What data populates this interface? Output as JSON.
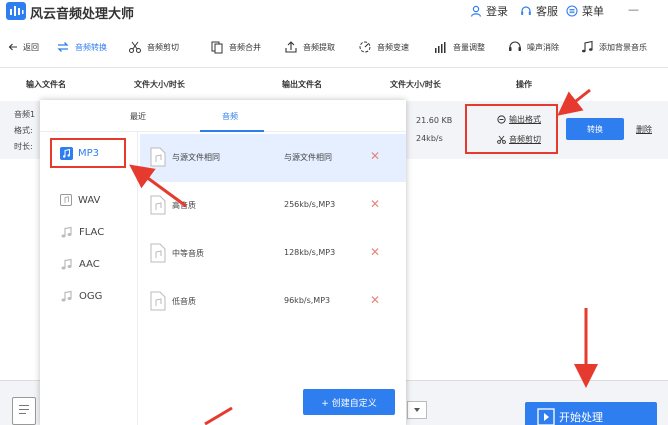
{
  "app": {
    "title": "风云音频处理大师",
    "login_label": "登录",
    "service_label": "客服",
    "menu_label": "菜单",
    "minimize_glyph": "—"
  },
  "toolbar": {
    "items": [
      {
        "label": "返回",
        "icon": "back-arrow-icon"
      },
      {
        "label": "音频转换",
        "icon": "convert-icon",
        "active": true
      },
      {
        "label": "音频剪切",
        "icon": "scissors-icon"
      },
      {
        "label": "音频合并",
        "icon": "merge-icon"
      },
      {
        "label": "音频提取",
        "icon": "extract-icon"
      },
      {
        "label": "音频变速",
        "icon": "speed-icon"
      },
      {
        "label": "音量调整",
        "icon": "volume-icon"
      },
      {
        "label": "噪声消除",
        "icon": "noise-icon"
      },
      {
        "label": "添加背景音乐",
        "icon": "music-note-icon"
      }
    ]
  },
  "columns": {
    "input_file": "输入文件名",
    "input_size": "文件大小/时长",
    "output_file": "输出文件名",
    "output_size": "文件大小/时长",
    "operation": "操作"
  },
  "file_row": {
    "name_prefix": "音频1",
    "format_prefix": "格式:",
    "duration_prefix": "时长:",
    "output_size": "21.60 KB",
    "output_bitrate": "24kb/s",
    "output_format_link": "输出格式",
    "audio_cut_link": "音频剪切",
    "convert_label": "转换",
    "delete_label": "删除"
  },
  "popup": {
    "tabs": [
      {
        "label": "最近",
        "active": false
      },
      {
        "label": "音频",
        "active": true
      }
    ],
    "formats": [
      {
        "label": "MP3",
        "selected": true
      },
      {
        "label": "WAV",
        "selected": false
      },
      {
        "label": "FLAC",
        "selected": false
      },
      {
        "label": "AAC",
        "selected": false
      },
      {
        "label": "OGG",
        "selected": false
      }
    ],
    "qualities": [
      {
        "name": "与源文件相同",
        "value": "与源文件相同",
        "selected": true
      },
      {
        "name": "高音质",
        "value": "256kb/s,MP3",
        "selected": false
      },
      {
        "name": "中等音质",
        "value": "128kb/s,MP3",
        "selected": false
      },
      {
        "name": "低音质",
        "value": "96kb/s,MP3",
        "selected": false
      }
    ],
    "remove_glyph": "✕",
    "create_custom_label": "+  创建自定义"
  },
  "bottom": {
    "start_label": "开始处理"
  },
  "colors": {
    "accent": "#2f7ef0",
    "highlight_red": "#e63a2e",
    "selected_row_bg": "#e5efff"
  }
}
